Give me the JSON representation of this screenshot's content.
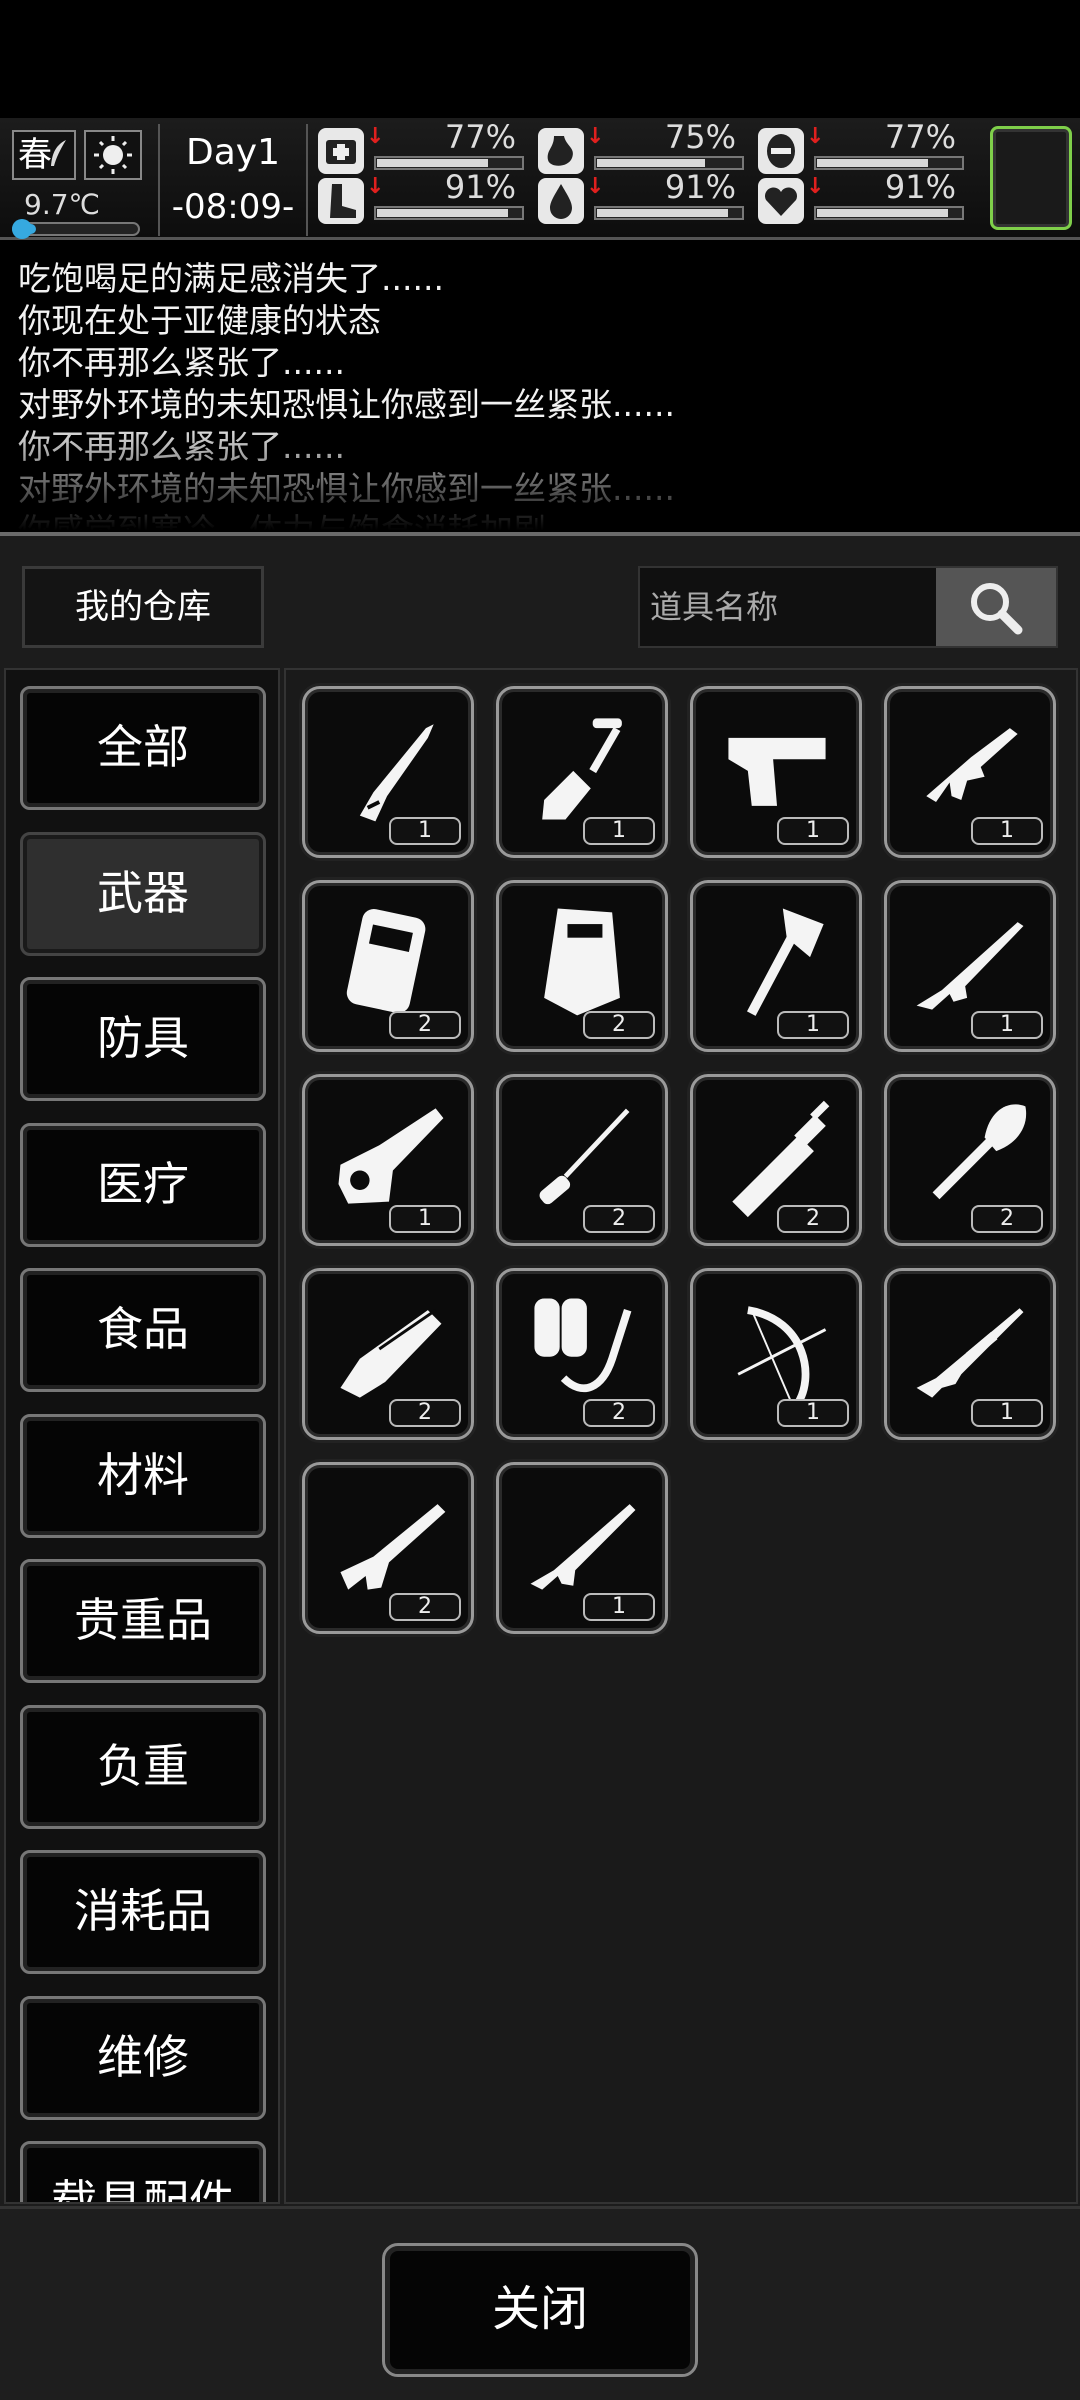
{
  "hud": {
    "season": "春",
    "temperature": "9.7℃",
    "temperature_fill_pct": 18,
    "day": "Day1",
    "time": "-08:09-",
    "stats": [
      {
        "icon": "medkit-icon",
        "value": "77%",
        "fill_pct": 77
      },
      {
        "icon": "stomach-icon",
        "value": "75%",
        "fill_pct": 75
      },
      {
        "icon": "mask-icon",
        "value": "77%",
        "fill_pct": 77
      },
      {
        "icon": "boot-icon",
        "value": "91%",
        "fill_pct": 91
      },
      {
        "icon": "water-drop-icon",
        "value": "91%",
        "fill_pct": 91
      },
      {
        "icon": "heart-icon",
        "value": "91%",
        "fill_pct": 91
      }
    ]
  },
  "log": [
    "吃饱喝足的满足感消失了......",
    "你现在处于亚健康的状态",
    "你不再那么紧张了......",
    "对野外环境的未知恐惧让你感到一丝紧张......",
    "你不再那么紧张了......",
    "对野外环境的未知恐惧让你感到一丝紧张......",
    "你感觉到寒冷，体力与饱食消耗加剧"
  ],
  "panel": {
    "warehouse_label": "我的仓库",
    "search_placeholder": "道具名称"
  },
  "categories": [
    "全部",
    "武器",
    "防具",
    "医疗",
    "食品",
    "材料",
    "贵重品",
    "负重",
    "消耗品",
    "维修",
    "载具配件"
  ],
  "active_category": "武器",
  "items": [
    {
      "name": "folding-knife-icon",
      "qty": "1"
    },
    {
      "name": "shovel-icon",
      "qty": "1"
    },
    {
      "name": "pistol-icon",
      "qty": "1"
    },
    {
      "name": "smg-icon",
      "qty": "1"
    },
    {
      "name": "backpack-armor-icon",
      "qty": "2"
    },
    {
      "name": "riot-shield-icon",
      "qty": "2"
    },
    {
      "name": "axe-icon",
      "qty": "1"
    },
    {
      "name": "assault-rifle-icon",
      "qty": "1"
    },
    {
      "name": "chainsaw-icon",
      "qty": "1"
    },
    {
      "name": "screwdriver-icon",
      "qty": "2"
    },
    {
      "name": "sword-icon",
      "qty": "2"
    },
    {
      "name": "spade-icon",
      "qty": "2"
    },
    {
      "name": "minigun-icon",
      "qty": "2"
    },
    {
      "name": "flamethrower-icon",
      "qty": "2"
    },
    {
      "name": "compound-bow-icon",
      "qty": "1"
    },
    {
      "name": "sniper-rifle-icon",
      "qty": "1"
    },
    {
      "name": "shotgun-icon",
      "qty": "2"
    },
    {
      "name": "rifle-icon",
      "qty": "1"
    }
  ],
  "bottom": {
    "close_label": "关闭"
  },
  "colors": {
    "accent_green": "#7fcf4a",
    "temp_blue": "#36a9e0",
    "warning_red": "#e0201e"
  }
}
